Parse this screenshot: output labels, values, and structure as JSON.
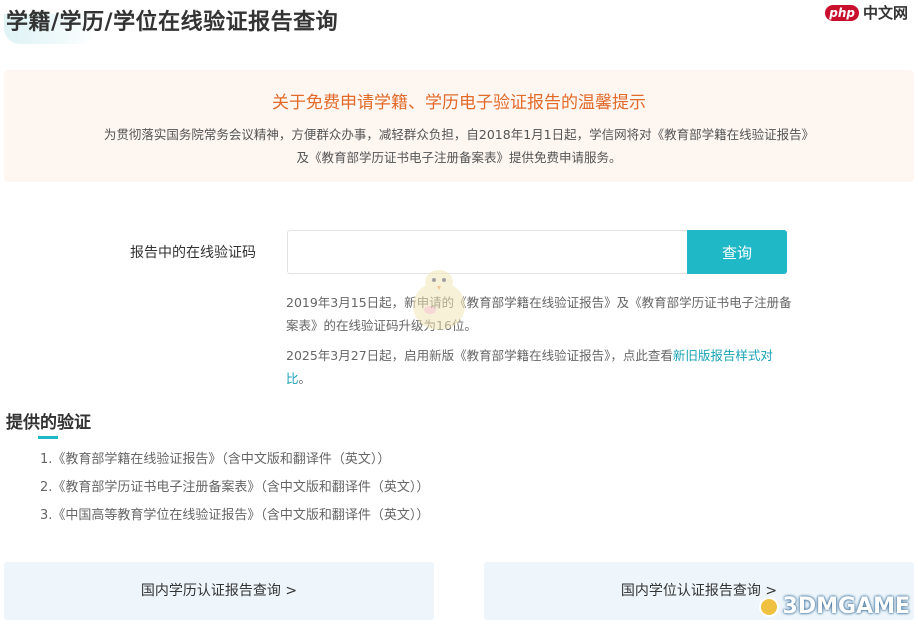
{
  "page": {
    "title": "学籍/学历/学位在线验证报告查询"
  },
  "watermarks": {
    "php_badge": "php",
    "php_text": "中文网",
    "bottom": "3DMGAME"
  },
  "notice": {
    "title": "关于免费申请学籍、学历电子验证报告的温馨提示",
    "body": "为贯彻落实国务院常务会议精神，方便群众办事，减轻群众负担，自2018年1月1日起，学信网将对《教育部学籍在线验证报告》及《教育部学历证书电子注册备案表》提供免费申请服务。"
  },
  "form": {
    "code_label": "报告中的在线验证码",
    "code_value": "",
    "query_label": "查询"
  },
  "hints": {
    "hint1": "2019年3月15日起，新申请的《教育部学籍在线验证报告》及《教育部学历证书电子注册备案表》的在线验证码升级为16位。",
    "hint2_prefix": "2025年3月27日起，启用新版《教育部学籍在线验证报告》，点此查看",
    "hint2_link": "新旧版报告样式对比",
    "hint2_suffix": "。"
  },
  "provided": {
    "title": "提供的验证",
    "items": [
      "1.《教育部学籍在线验证报告》（含中文版和翻译件（英文））",
      "2.《教育部学历证书电子注册备案表》（含中文版和翻译件（英文））",
      "3.《中国高等教育学位在线验证报告》（含中文版和翻译件（英文））"
    ]
  },
  "entries": {
    "left": "国内学历认证报告查询 >",
    "right": "国内学位认证报告查询 >"
  },
  "colors": {
    "accent": "#1fb8c7",
    "notice_title": "#e26a2a",
    "notice_bg": "#fdf6f1",
    "card_bg": "#eef6fb"
  }
}
